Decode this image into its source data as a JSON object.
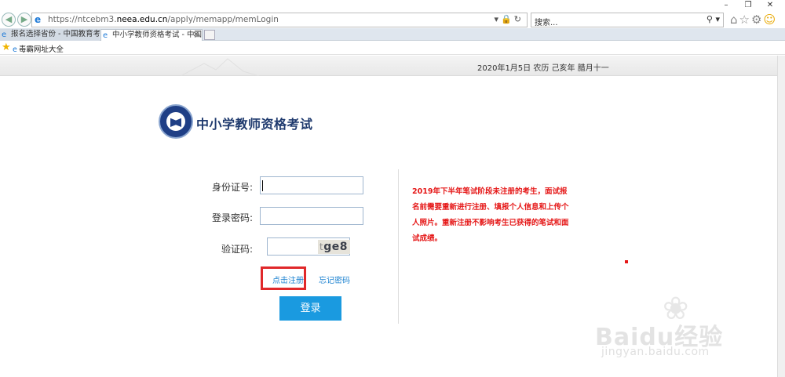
{
  "browser": {
    "url_prefix": "https://ntcebm3.",
    "url_domain": "neea.edu.cn",
    "url_path": "/apply/memapp/memLogin",
    "search_placeholder": "搜索...",
    "tabs": [
      {
        "label": "报名选择省份 - 中国教育考试网",
        "active": false
      },
      {
        "label": "中小学教师资格考试 - 中国...",
        "active": true
      }
    ],
    "favorites": [
      {
        "label": "毒霸网址大全"
      }
    ]
  },
  "page": {
    "date_line": "2020年1月5日 农历 己亥年 腊月十一",
    "site_title": "中小学教师资格考试",
    "form": {
      "id_label": "身份证号:",
      "id_value": "",
      "password_label": "登录密码:",
      "password_value": "",
      "captcha_label": "验证码:",
      "captcha_value": "",
      "captcha_text_faint": "t",
      "captcha_text": "ge8",
      "register_link": "点击注册",
      "forgot_link": "忘记密码",
      "login_button": "登录"
    },
    "notice": "2019年下半年笔试阶段未注册的考生，面试报名前需要重新进行注册、填报个人信息和上传个人照片。重新注册不影响考生已获得的笔试和面试成绩。"
  },
  "watermark": {
    "text": "Baidu经验",
    "url": "jingyan.baidu.com"
  },
  "colors": {
    "login_button": "#1a9ae0",
    "notice_text": "#e51717",
    "highlight_box": "#e0282a",
    "title": "#1f3a6e",
    "link": "#1d83d1"
  },
  "icons": [
    "back-icon",
    "forward-icon",
    "ie-icon",
    "dropdown-icon",
    "lock-icon",
    "refresh-icon",
    "search-icon",
    "home-icon",
    "star-icon",
    "gear-icon",
    "smiley-icon",
    "close-icon",
    "new-tab-icon",
    "favorites-star-icon",
    "minimize-icon",
    "restore-icon",
    "window-close-icon"
  ]
}
